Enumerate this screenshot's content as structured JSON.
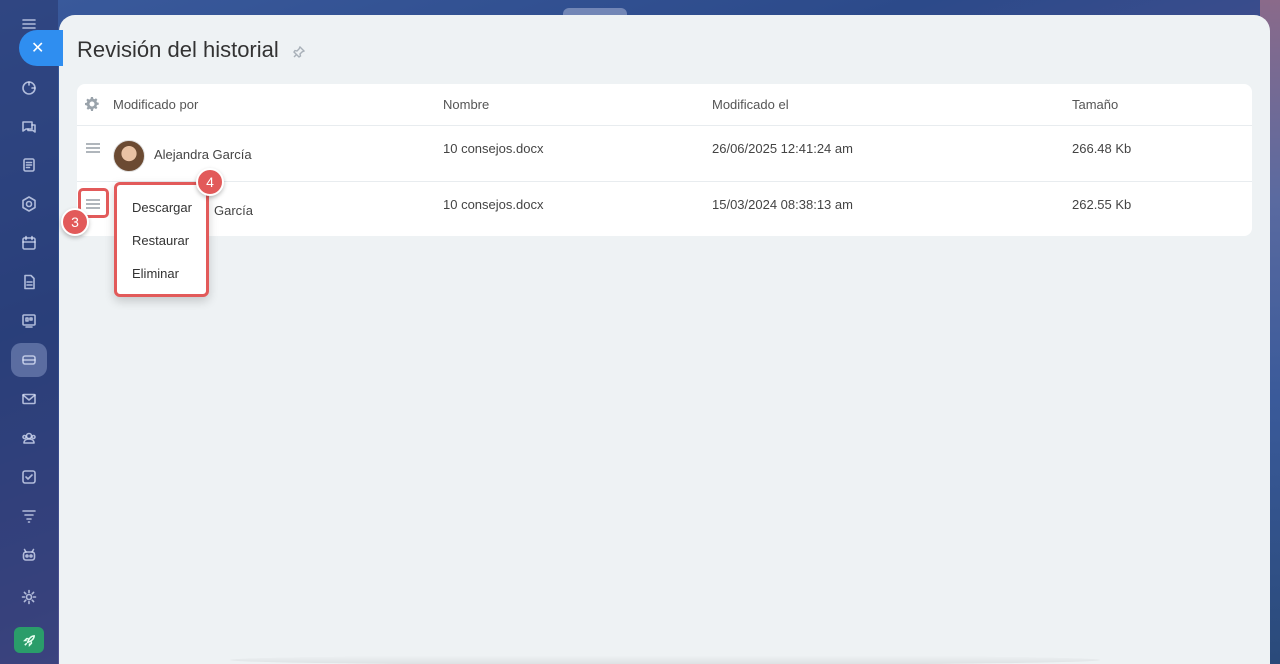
{
  "window": {
    "close_label": "✕"
  },
  "page": {
    "title": "Revisión del historial"
  },
  "table": {
    "columns": [
      "Modificado por",
      "Nombre",
      "Modificado el",
      "Tamaño"
    ],
    "rows": [
      {
        "user": "Alejandra García",
        "name": "10 consejos.docx",
        "modified": "26/06/2025 12:41:24 am",
        "size": "266.48 Kb"
      },
      {
        "user": "Alejandra García",
        "user_visible": "García",
        "name": "10 consejos.docx",
        "modified": "15/03/2024 08:38:13 am",
        "size": "262.55 Kb"
      }
    ]
  },
  "context_menu": {
    "items": [
      "Descargar",
      "Restaurar",
      "Eliminar"
    ]
  },
  "annotations": {
    "step3": "3",
    "step4": "4"
  },
  "sidebar": {
    "icons": [
      "menu-icon",
      "goals-icon",
      "chat-icon",
      "feed-icon",
      "hexagon-icon",
      "calendar-icon",
      "document-icon",
      "board-icon",
      "drive-icon",
      "mail-icon",
      "group-icon",
      "tasks-icon",
      "filter-icon",
      "robot-icon",
      "settings-icon",
      "rocket-icon"
    ]
  },
  "colors": {
    "accent": "#2f8ef0",
    "link": "#2067b0",
    "highlight": "#e25a5a",
    "rocket": "#2a9d6a"
  }
}
